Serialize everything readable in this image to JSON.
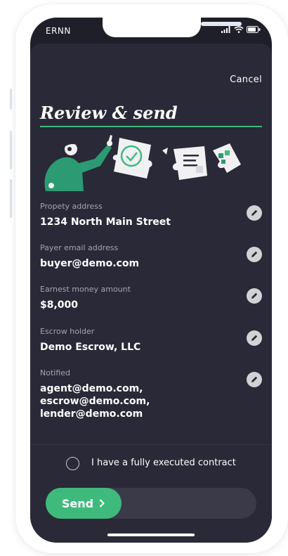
{
  "status_bar": {
    "carrier": "ERNN",
    "icons": [
      "signal-icon",
      "wifi-icon",
      "battery-icon"
    ]
  },
  "header": {
    "cancel_label": "Cancel",
    "title": "Review & send"
  },
  "fields": [
    {
      "label": "Propety address",
      "value": "1234 North Main Street"
    },
    {
      "label": "Payer email address",
      "value": "buyer@demo.com"
    },
    {
      "label": "Earnest money amount",
      "value": "$8,000"
    },
    {
      "label": "Escrow holder",
      "value": "Demo Escrow, LLC"
    },
    {
      "label": "Notified",
      "value_line1": "agent@demo.com, escrow@demo.com,",
      "value_line2": "lender@demo.com"
    }
  ],
  "contract_checkbox": {
    "label": "I have a fully executed contract",
    "checked": false
  },
  "send": {
    "label": "Send"
  },
  "colors": {
    "accent": "#3fba7d",
    "sheet": "#292937",
    "background": "#1f1f2a"
  }
}
